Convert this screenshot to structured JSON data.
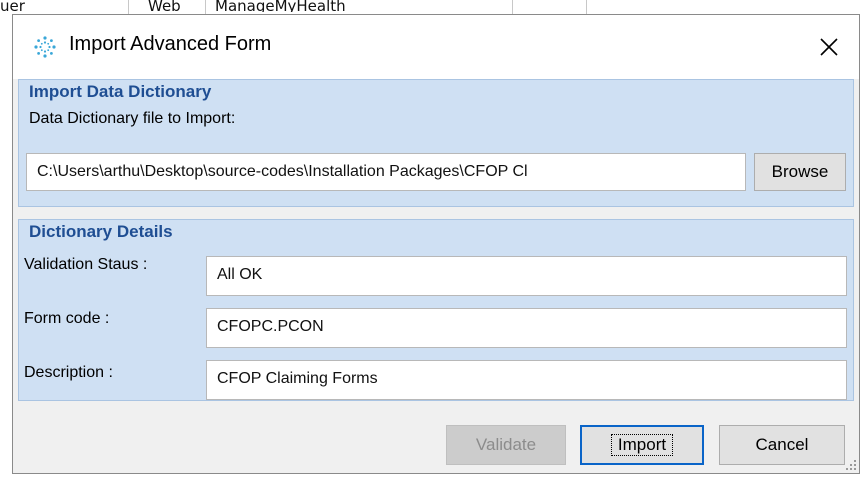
{
  "background": {
    "cells": [
      "uer",
      "Web",
      "ManageMyHealth"
    ]
  },
  "dialog": {
    "title": "Import Advanced Form",
    "close_glyph": "✕",
    "icon": "app-spark-icon",
    "accent": "#1f4e93",
    "import_group": {
      "title": "Import Data Dictionary",
      "file_label": "Data Dictionary file to Import:",
      "file_path": "C:\\Users\\arthu\\Desktop\\source-codes\\Installation Packages\\CFOP Cl",
      "browse_label": "Browse"
    },
    "details_group": {
      "title": "Dictionary Details",
      "rows": [
        {
          "label": "Validation Staus :",
          "value": "All OK"
        },
        {
          "label": "Form code :",
          "value": "CFOPC.PCON"
        },
        {
          "label": "Description :",
          "value": "CFOP Claiming Forms"
        }
      ]
    },
    "buttons": {
      "validate": "Validate",
      "import": "Import",
      "cancel": "Cancel"
    }
  }
}
